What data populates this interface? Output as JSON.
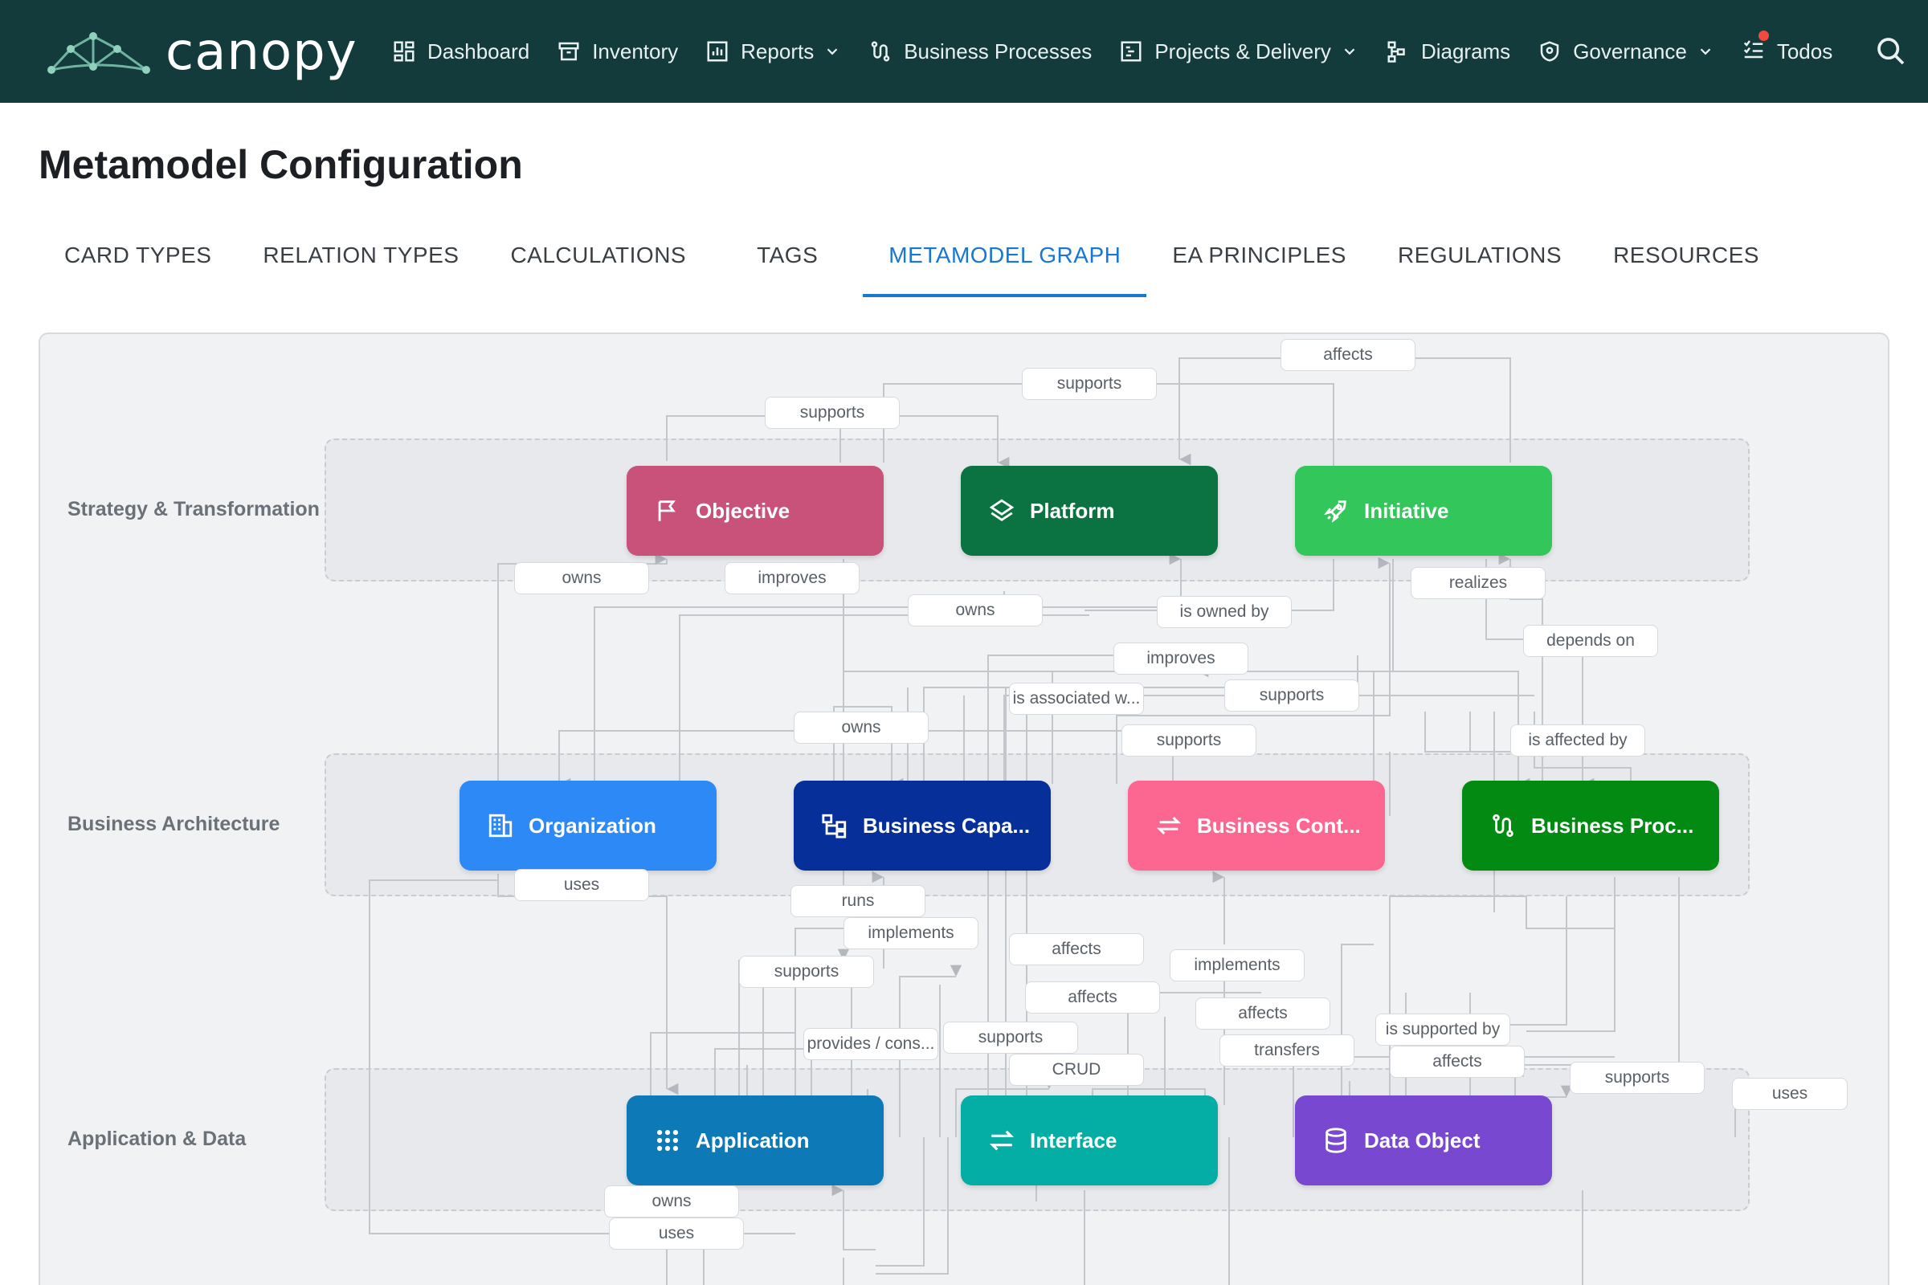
{
  "brand": {
    "name": "canopy"
  },
  "nav": {
    "items": [
      {
        "label": "Dashboard",
        "icon": "dashboard-icon",
        "dropdown": false
      },
      {
        "label": "Inventory",
        "icon": "inventory-icon",
        "dropdown": false
      },
      {
        "label": "Reports",
        "icon": "reports-icon",
        "dropdown": true
      },
      {
        "label": "Business Processes",
        "icon": "process-icon",
        "dropdown": false
      },
      {
        "label": "Projects & Delivery",
        "icon": "projects-icon",
        "dropdown": true
      },
      {
        "label": "Diagrams",
        "icon": "diagrams-icon",
        "dropdown": false
      },
      {
        "label": "Governance",
        "icon": "shield-icon",
        "dropdown": true
      },
      {
        "label": "Todos",
        "icon": "todos-icon",
        "dropdown": false,
        "badge": true
      }
    ]
  },
  "page": {
    "title": "Metamodel Configuration"
  },
  "tabs": [
    {
      "label": "CARD TYPES"
    },
    {
      "label": "RELATION TYPES"
    },
    {
      "label": "CALCULATIONS"
    },
    {
      "label": "TAGS"
    },
    {
      "label": "METAMODEL GRAPH",
      "active": true
    },
    {
      "label": "EA PRINCIPLES"
    },
    {
      "label": "REGULATIONS"
    },
    {
      "label": "RESOURCES"
    }
  ],
  "graph": {
    "lanes": [
      {
        "label": "Strategy & Transformation"
      },
      {
        "label": "Business Architecture"
      },
      {
        "label": "Application & Data"
      }
    ],
    "nodes": [
      {
        "id": "objective",
        "label": "Objective",
        "icon": "flag-icon",
        "color": "#c8527a"
      },
      {
        "id": "platform",
        "label": "Platform",
        "icon": "layers-icon",
        "color": "#0b7341"
      },
      {
        "id": "initiative",
        "label": "Initiative",
        "icon": "rocket-icon",
        "color": "#33c65a"
      },
      {
        "id": "organization",
        "label": "Organization",
        "icon": "building-icon",
        "color": "#2d89f5"
      },
      {
        "id": "business-capability",
        "label": "Business Capa...",
        "icon": "hierarchy-icon",
        "color": "#062f9a"
      },
      {
        "id": "business-context",
        "label": "Business Cont...",
        "icon": "arrows-exchange-icon",
        "color": "#fb6791"
      },
      {
        "id": "business-process",
        "label": "Business Proc...",
        "icon": "process-icon",
        "color": "#038a12"
      },
      {
        "id": "application",
        "label": "Application",
        "icon": "grid-dots-icon",
        "color": "#0e79b7"
      },
      {
        "id": "interface",
        "label": "Interface",
        "icon": "transfer-icon",
        "color": "#04aea4"
      },
      {
        "id": "data-object",
        "label": "Data Object",
        "icon": "database-icon",
        "color": "#7848d0"
      }
    ],
    "edge_labels": [
      "affects",
      "supports",
      "supports",
      "owns",
      "improves",
      "owns",
      "is owned by",
      "realizes",
      "depends on",
      "improves",
      "is associated w...",
      "supports",
      "owns",
      "supports",
      "is affected by",
      "uses",
      "runs",
      "implements",
      "affects",
      "supports",
      "implements",
      "affects",
      "affects",
      "is supported by",
      "provides / cons...",
      "supports",
      "transfers",
      "affects",
      "CRUD",
      "supports",
      "uses",
      "owns",
      "uses"
    ]
  }
}
